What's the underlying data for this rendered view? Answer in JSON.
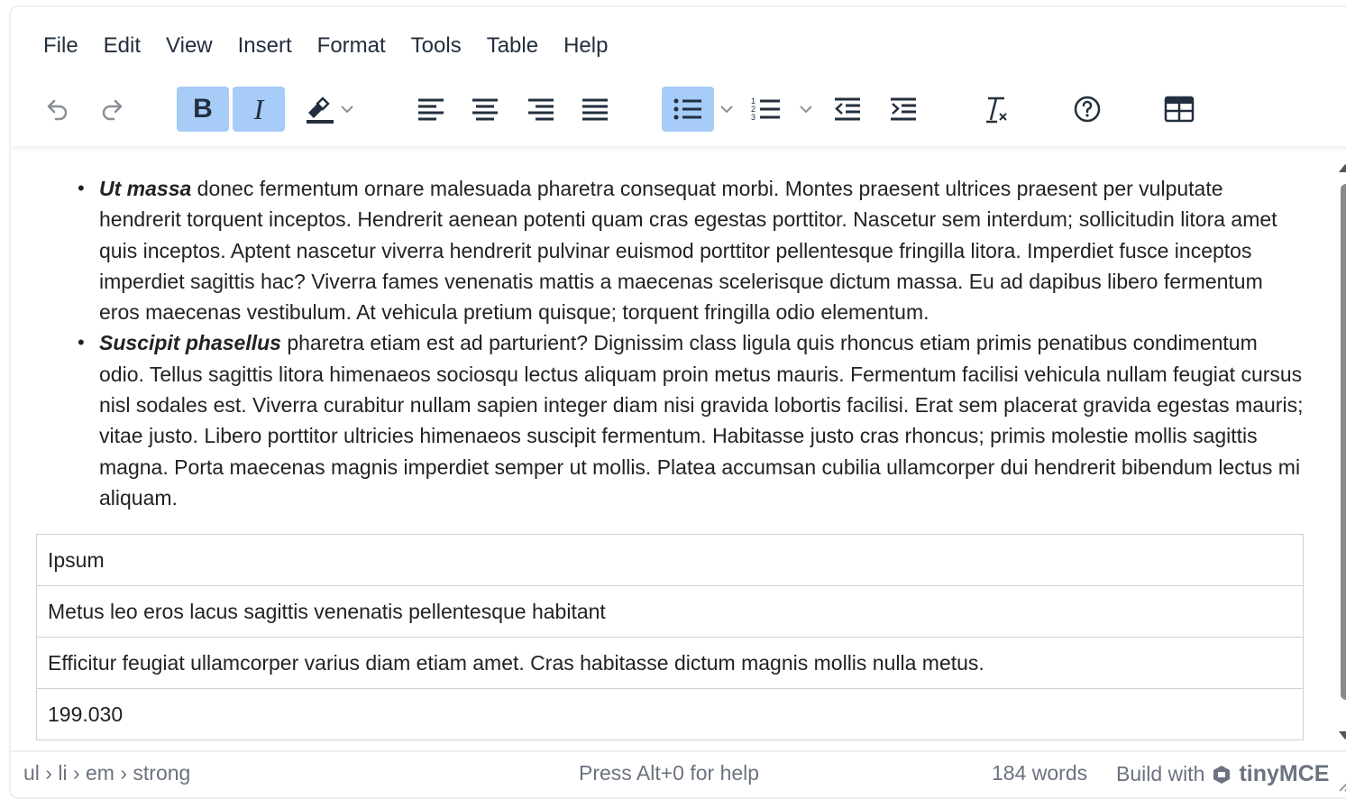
{
  "menubar": {
    "items": [
      "File",
      "Edit",
      "View",
      "Insert",
      "Format",
      "Tools",
      "Table",
      "Help"
    ]
  },
  "toolbar": {
    "undo": "undo-icon",
    "redo": "redo-icon",
    "bold": "B",
    "italic": "I",
    "highlight": "highlight-icon",
    "align_left": "align-left-icon",
    "align_center": "align-center-icon",
    "align_right": "align-right-icon",
    "justify": "justify-icon",
    "bullet_list": "bullet-list-icon",
    "numbered_list": "numbered-list-icon",
    "outdent": "outdent-icon",
    "indent": "indent-icon",
    "clear_format": "clear-formatting-icon",
    "help": "help-icon",
    "table": "table-icon",
    "active_color": "#a6ccf7"
  },
  "content": {
    "list": [
      {
        "lead": "Ut massa",
        "text": " donec fermentum ornare malesuada pharetra consequat morbi. Montes praesent ultrices praesent per vulputate hendrerit torquent inceptos. Hendrerit aenean potenti quam cras egestas porttitor. Nascetur sem interdum; sollicitudin litora amet quis inceptos. Aptent nascetur viverra hendrerit pulvinar euismod porttitor pellentesque fringilla litora. Imperdiet fusce inceptos imperdiet sagittis hac? Viverra fames venenatis mattis a maecenas scelerisque dictum massa. Eu ad dapibus libero fermentum eros maecenas vestibulum. At vehicula pretium quisque; torquent fringilla odio elementum."
      },
      {
        "lead": "Suscipit phasellus",
        "text": " pharetra etiam est ad parturient? Dignissim class ligula quis rhoncus etiam primis penatibus condimentum odio. Tellus sagittis litora himenaeos sociosqu lectus aliquam proin metus mauris. Fermentum facilisi vehicula nullam feugiat cursus nisl sodales est. Viverra curabitur nullam sapien integer diam nisi gravida lobortis facilisi. Erat sem placerat gravida egestas mauris; vitae justo. Libero porttitor ultricies himenaeos suscipit fermentum. Habitasse justo cras rhoncus; primis molestie mollis sagittis magna. Porta maecenas magnis imperdiet semper ut mollis. Platea accumsan cubilia ullamcorper dui hendrerit bibendum lectus mi aliquam."
      }
    ],
    "table_rows": [
      "Ipsum",
      "Metus leo eros lacus sagittis venenatis pellentesque habitant",
      "Efficitur feugiat ullamcorper varius diam etiam amet. Cras habitasse dictum magnis mollis nulla metus.",
      "199.030"
    ]
  },
  "status": {
    "path": "ul › li › em › strong",
    "help": "Press Alt+0 for help",
    "words": "184 words",
    "build_with": "Build with",
    "brand": "tinyMCE"
  }
}
